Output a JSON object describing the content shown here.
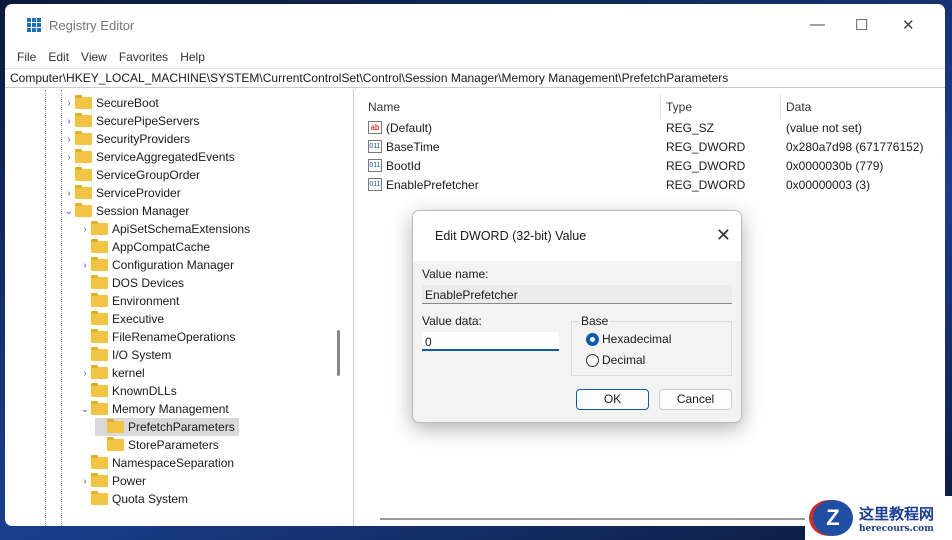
{
  "window": {
    "title": "Registry Editor",
    "minimize": "—",
    "maximize": "☐",
    "close": "✕"
  },
  "menu": [
    "File",
    "Edit",
    "View",
    "Favorites",
    "Help"
  ],
  "address": "Computer\\HKEY_LOCAL_MACHINE\\SYSTEM\\CurrentControlSet\\Control\\Session Manager\\Memory Management\\PrefetchParameters",
  "tree": [
    {
      "label": "SecureBoot",
      "level": 1,
      "chevron": ">"
    },
    {
      "label": "SecurePipeServers",
      "level": 1,
      "chevron": ">"
    },
    {
      "label": "SecurityProviders",
      "level": 1,
      "chevron": ">"
    },
    {
      "label": "ServiceAggregatedEvents",
      "level": 1,
      "chevron": ">"
    },
    {
      "label": "ServiceGroupOrder",
      "level": 1,
      "chevron": ""
    },
    {
      "label": "ServiceProvider",
      "level": 1,
      "chevron": ">"
    },
    {
      "label": "Session Manager",
      "level": 1,
      "chevron": "v"
    },
    {
      "label": "ApiSetSchemaExtensions",
      "level": 2,
      "chevron": ">"
    },
    {
      "label": "AppCompatCache",
      "level": 2,
      "chevron": ""
    },
    {
      "label": "Configuration Manager",
      "level": 2,
      "chevron": ">"
    },
    {
      "label": "DOS Devices",
      "level": 2,
      "chevron": ""
    },
    {
      "label": "Environment",
      "level": 2,
      "chevron": ""
    },
    {
      "label": "Executive",
      "level": 2,
      "chevron": ""
    },
    {
      "label": "FileRenameOperations",
      "level": 2,
      "chevron": ""
    },
    {
      "label": "I/O System",
      "level": 2,
      "chevron": ""
    },
    {
      "label": "kernel",
      "level": 2,
      "chevron": ">"
    },
    {
      "label": "KnownDLLs",
      "level": 2,
      "chevron": ""
    },
    {
      "label": "Memory Management",
      "level": 2,
      "chevron": "v"
    },
    {
      "label": "PrefetchParameters",
      "level": 3,
      "chevron": "",
      "selected": true
    },
    {
      "label": "StoreParameters",
      "level": 3,
      "chevron": ""
    },
    {
      "label": "NamespaceSeparation",
      "level": 2,
      "chevron": ""
    },
    {
      "label": "Power",
      "level": 2,
      "chevron": ">"
    },
    {
      "label": "Quota System",
      "level": 2,
      "chevron": ""
    }
  ],
  "columns": {
    "name": "Name",
    "type": "Type",
    "data": "Data"
  },
  "values": [
    {
      "icon": "ab",
      "name": "(Default)",
      "type": "REG_SZ",
      "data": "(value not set)"
    },
    {
      "icon": "011",
      "name": "BaseTime",
      "type": "REG_DWORD",
      "data": "0x280a7d98 (671776152)"
    },
    {
      "icon": "011",
      "name": "BootId",
      "type": "REG_DWORD",
      "data": "0x0000030b (779)"
    },
    {
      "icon": "011",
      "name": "EnablePrefetcher",
      "type": "REG_DWORD",
      "data": "0x00000003 (3)"
    }
  ],
  "dialog": {
    "title": "Edit DWORD (32-bit) Value",
    "close": "✕",
    "value_name_label": "Value name:",
    "value_name": "EnablePrefetcher",
    "value_data_label": "Value data:",
    "value_data": "0",
    "base_label": "Base",
    "hex_label": "Hexadecimal",
    "dec_label": "Decimal",
    "base_selected": "Hexadecimal",
    "ok": "OK",
    "cancel": "Cancel"
  },
  "watermark": {
    "title": "这里教程网",
    "url": "herecours.com",
    "logo": "Z"
  }
}
